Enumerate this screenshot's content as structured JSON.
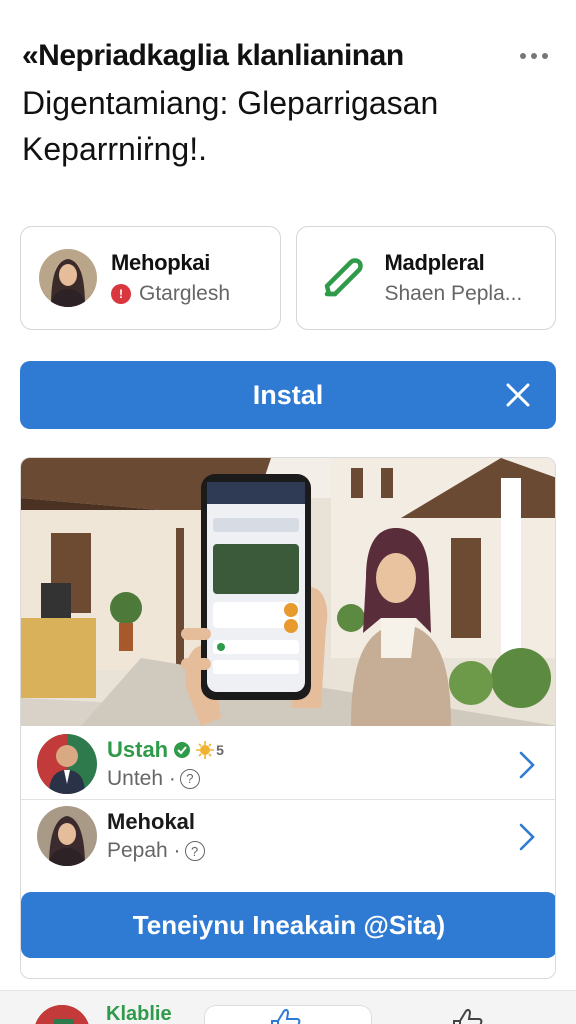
{
  "header": {
    "title": "«Nepriadkaglia klanlianinan",
    "subtitle": "Digentamiang: Gleparrigasan Keparrniṙng!."
  },
  "cards": [
    {
      "name": "Mehopkai",
      "sub": "Gtarglesh",
      "icon": "avatar-woman-hijab"
    },
    {
      "name": "Madpleral",
      "sub": "Shaen Pepla...",
      "icon": "pencil-icon"
    }
  ],
  "install": {
    "label": "Instal"
  },
  "list": [
    {
      "name": "Ustah",
      "sub": "Unteh ·",
      "badge_text": "5"
    },
    {
      "name": "Mehokal",
      "sub": "Pepah ·"
    }
  ],
  "cta": {
    "label": "Teneiynu Ineakain @Sita)"
  },
  "bottom_bar": {
    "name": "Klablie"
  },
  "colors": {
    "accent": "#2f7bd3",
    "verified": "#2f9b4a",
    "danger": "#d9363e"
  }
}
